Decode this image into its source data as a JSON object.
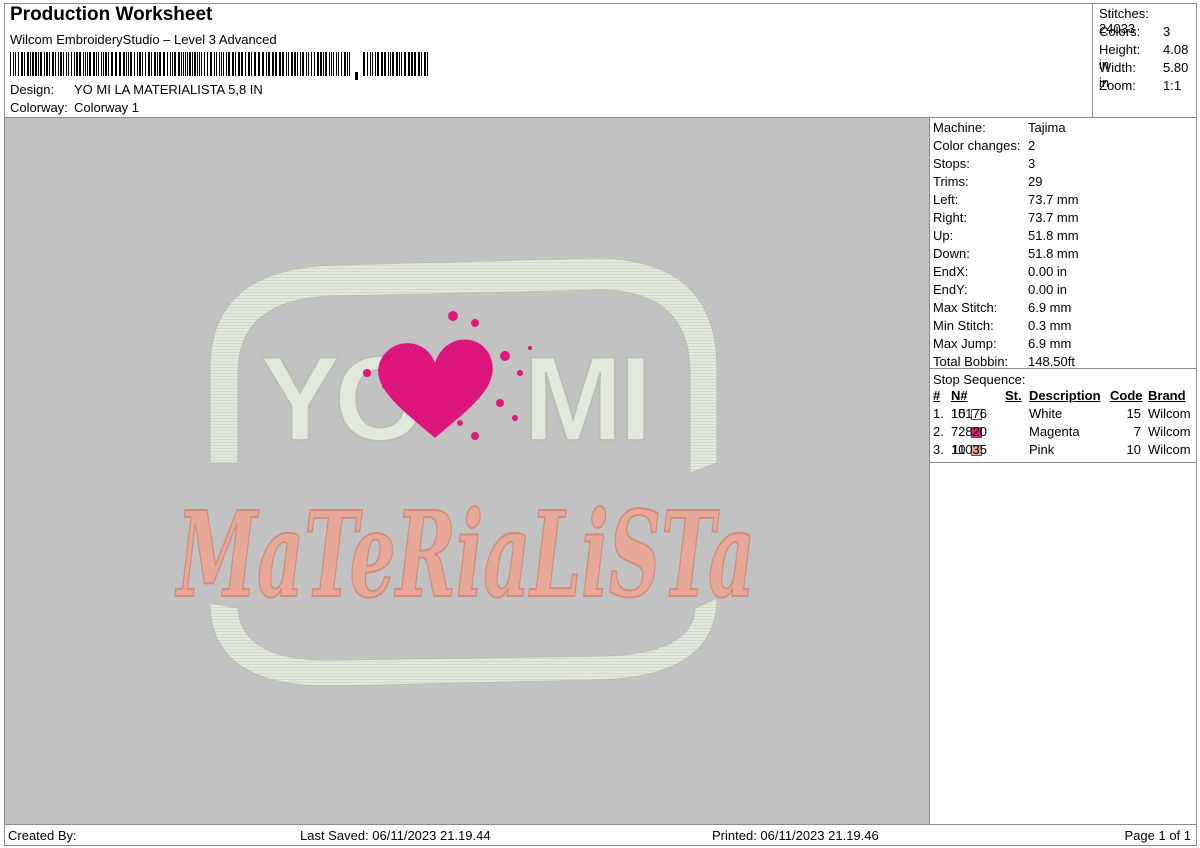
{
  "header": {
    "title": "Production Worksheet",
    "subtitle": "Wilcom EmbroideryStudio – Level 3 Advanced",
    "design_label": "Design:",
    "design_value": "YO MI LA MATERIALISTA 5,8 IN",
    "colorway_label": "Colorway:",
    "colorway_value": "Colorway 1"
  },
  "stats": [
    {
      "label": "Stitches:",
      "value": "24033"
    },
    {
      "label": "Colors:",
      "value": "3"
    },
    {
      "label": "Height:",
      "value": "4.08 in"
    },
    {
      "label": "Width:",
      "value": "5.80 in"
    },
    {
      "label": "Zoom:",
      "value": "1:1"
    }
  ],
  "info": [
    {
      "label": "Machine:",
      "value": "Tajima"
    },
    {
      "label": "Color changes:",
      "value": "2"
    },
    {
      "label": "Stops:",
      "value": "3"
    },
    {
      "label": "Trims:",
      "value": "29"
    },
    {
      "label": "Left:",
      "value": "73.7 mm"
    },
    {
      "label": "Right:",
      "value": "73.7 mm"
    },
    {
      "label": "Up:",
      "value": "51.8 mm"
    },
    {
      "label": "Down:",
      "value": "51.8 mm"
    },
    {
      "label": "EndX:",
      "value": "0.00 in"
    },
    {
      "label": "EndY:",
      "value": "0.00 in"
    },
    {
      "label": "Max Stitch:",
      "value": "6.9 mm"
    },
    {
      "label": "Min Stitch:",
      "value": "0.3 mm"
    },
    {
      "label": "Max Jump:",
      "value": "6.9 mm"
    },
    {
      "label": "Total Bobbin:",
      "value": "148.50ft"
    }
  ],
  "stop_sequence": {
    "title": "Stop Sequence:",
    "headers": {
      "num": "#",
      "n": "N#",
      "st": "St.",
      "desc": "Description",
      "code": "Code",
      "brand": "Brand"
    },
    "rows": [
      {
        "num": "1.",
        "n": "15",
        "st": "10176",
        "desc": "White",
        "code": "15",
        "brand": "Wilcom",
        "color": "#ffffff"
      },
      {
        "num": "2.",
        "n": "7",
        "st": "2820",
        "desc": "Magenta",
        "code": "7",
        "brand": "Wilcom",
        "color": "#e0157e"
      },
      {
        "num": "3.",
        "n": "10",
        "st": "11035",
        "desc": "Pink",
        "code": "10",
        "brand": "Wilcom",
        "color": "#eda59c"
      }
    ]
  },
  "design": {
    "line1_left": "YO",
    "line1_right": "MI",
    "line2": "MaTeRiaLiSTa",
    "thread_white": "#e2e9dc",
    "thread_magenta": "#e0157e",
    "thread_pink": "#e8a898"
  },
  "footer": {
    "created_by": "Created By:",
    "last_saved": "Last Saved: 06/11/2023 21.19.44",
    "printed": "Printed: 06/11/2023 21.19.46",
    "page": "Page 1 of 1"
  }
}
